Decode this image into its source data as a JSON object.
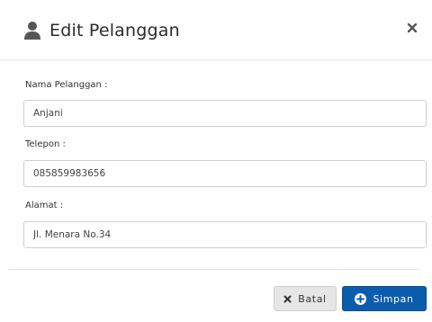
{
  "modal": {
    "title": "Edit Pelanggan",
    "close_icon": "close-icon",
    "title_icon": "user-icon"
  },
  "form": {
    "name_label": "Nama Pelanggan :",
    "name_value": "Anjani",
    "phone_label": "Telepon :",
    "phone_value": "085859983656",
    "address_label": "Alamat :",
    "address_value": "Jl. Menara No.34"
  },
  "footer": {
    "cancel_label": "Batal",
    "cancel_icon": "x-icon",
    "save_label": "Simpan",
    "save_icon": "plus-circle-icon"
  },
  "colors": {
    "primary": "#0b5cad",
    "cancel_bg": "#e6e6e6"
  }
}
